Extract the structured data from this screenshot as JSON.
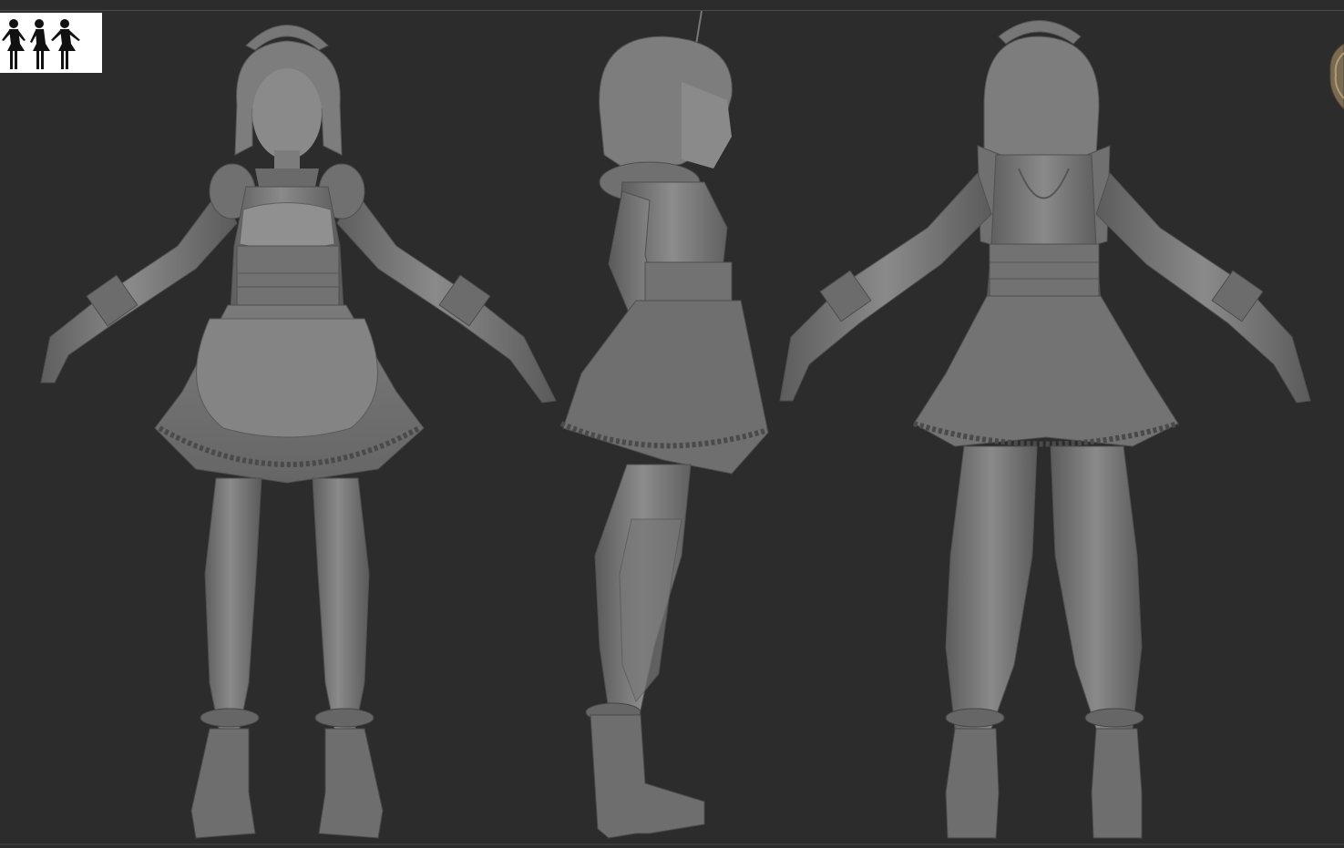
{
  "scene": {
    "background_color": "#2c2c2c",
    "model_color": "#7b7b7b",
    "model_shadow_color": "#555555",
    "model_highlight_color": "#a3a3a3",
    "views": [
      {
        "name": "front",
        "icon": "figure-front"
      },
      {
        "name": "side",
        "icon": "figure-side"
      },
      {
        "name": "back",
        "icon": "figure-back"
      }
    ]
  },
  "navigator": {
    "icon": "silhouette-thumbnail",
    "background_color": "#ffffff",
    "silhouette_color": "#111111"
  }
}
